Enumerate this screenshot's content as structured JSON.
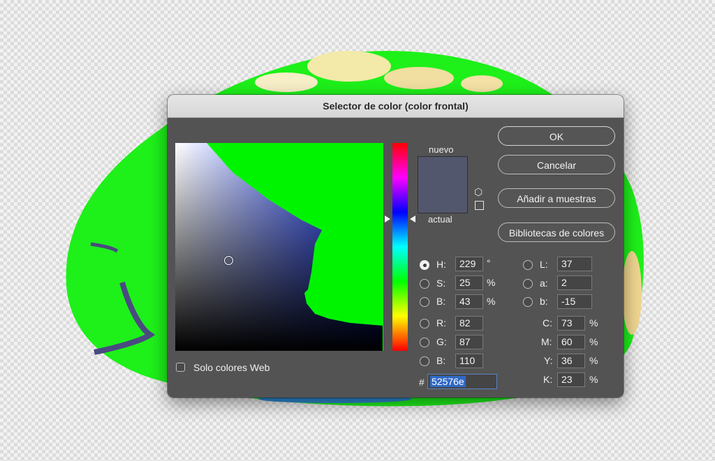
{
  "dialog": {
    "title": "Selector de color (color frontal)",
    "new_label": "nuevo",
    "current_label": "actual",
    "new_color": "#52576e",
    "current_color": "#52576e",
    "web_only_label": "Solo colores Web",
    "web_only_checked": false
  },
  "buttons": {
    "ok": "OK",
    "cancel": "Cancelar",
    "add_to_swatches": "Añadir a muestras",
    "color_libraries": "Bibliotecas de colores"
  },
  "hsb": {
    "h_label": "H:",
    "h_value": "229",
    "h_unit": "°",
    "s_label": "S:",
    "s_value": "25",
    "s_unit": "%",
    "b_label": "B:",
    "b_value": "43",
    "b_unit": "%"
  },
  "rgb": {
    "r_label": "R:",
    "r_value": "82",
    "g_label": "G:",
    "g_value": "87",
    "b_label": "B:",
    "b_value": "110"
  },
  "lab": {
    "l_label": "L:",
    "l_value": "37",
    "a_label": "a:",
    "a_value": "2",
    "b_label": "b:",
    "b_value": "-15"
  },
  "cmyk": {
    "c_label": "C:",
    "c_value": "73",
    "c_unit": "%",
    "m_label": "M:",
    "m_value": "60",
    "m_unit": "%",
    "y_label": "Y:",
    "y_value": "36",
    "y_unit": "%",
    "k_label": "K:",
    "k_value": "23",
    "k_unit": "%"
  },
  "hex": {
    "prefix": "#",
    "value": "52576e"
  },
  "selected_mode": "H",
  "colors": {
    "dialog_bg": "#535353",
    "gamut_warning": "#00f400",
    "hex_selection": "#3069c6"
  }
}
